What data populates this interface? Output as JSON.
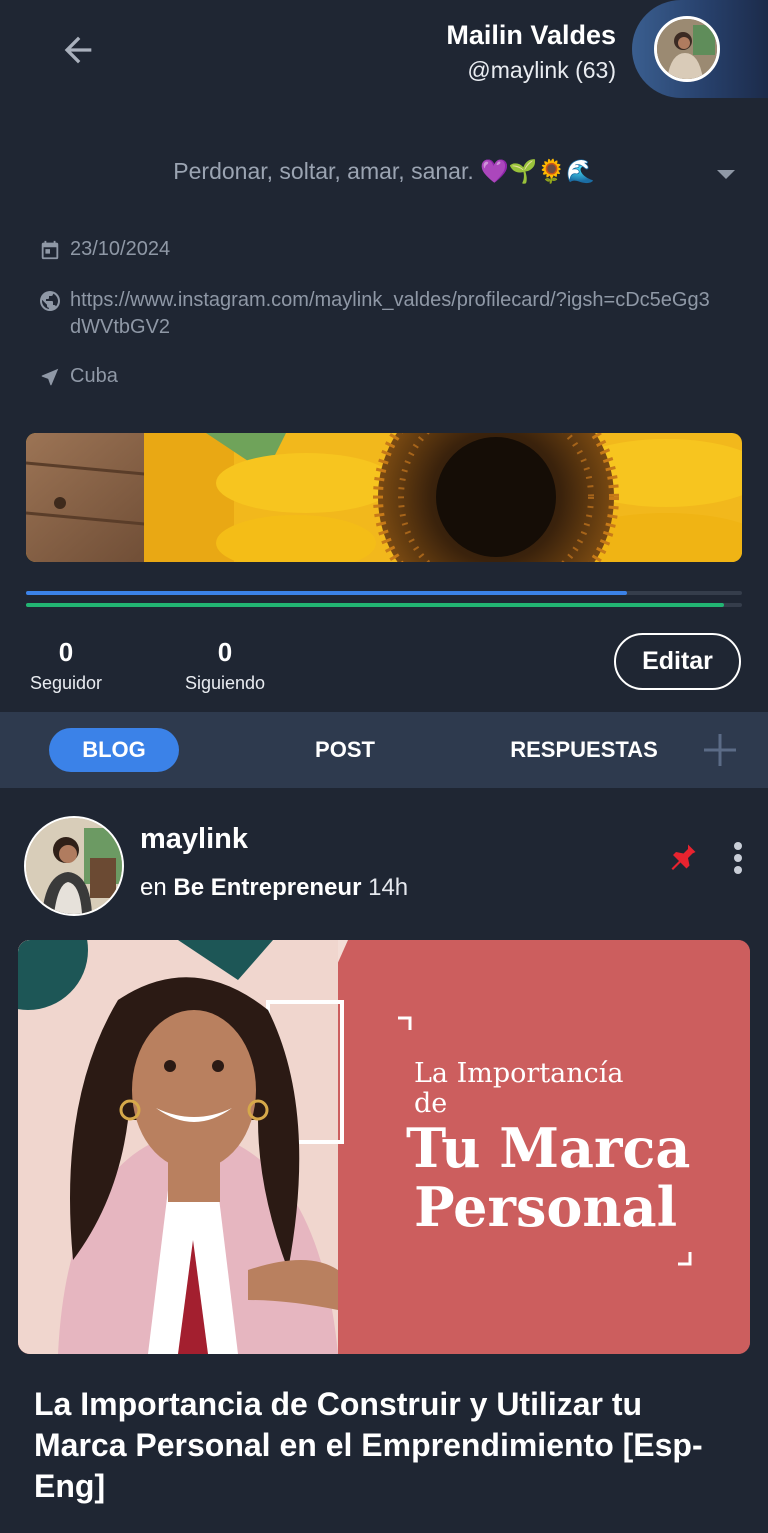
{
  "header": {
    "back_icon": "arrow-left-icon",
    "user_name": "Mailin Valdes",
    "user_handle": "@maylink (63)"
  },
  "profile": {
    "bio": "Perdonar, soltar, amar, sanar. 💜🌱🌻🌊",
    "date": "23/10/2024",
    "website": "https://www.instagram.com/maylink_valdes/profilecard/?igsh=cDc5eGg3dWVtbGV2",
    "location": "Cuba",
    "progress": {
      "blue_fraction": 0.84,
      "green_fraction": 0.975
    },
    "colors": {
      "progress_blue": "#3b82e8",
      "progress_green": "#22b573",
      "tab_active": "#3b82e8",
      "pin": "#e8232f"
    }
  },
  "stats": {
    "followers_count": "0",
    "followers_label": "Seguidor",
    "following_count": "0",
    "following_label": "Siguiendo",
    "edit_label": "Editar"
  },
  "tabs": [
    {
      "label": "BLOG",
      "active": true
    },
    {
      "label": "POST",
      "active": false
    },
    {
      "label": "RESPUESTAS",
      "active": false
    }
  ],
  "post": {
    "author": "maylink",
    "community_prefix": "en",
    "community": "Be Entrepreneur",
    "time": "14h",
    "image_text": {
      "line1": "La Importancía",
      "line2": "de",
      "line3": "Tu Marca",
      "line4": "Personal"
    },
    "title": "La Importancia de Construir y Utilizar tu Marca Personal en el Emprendimiento [Esp-Eng]"
  }
}
